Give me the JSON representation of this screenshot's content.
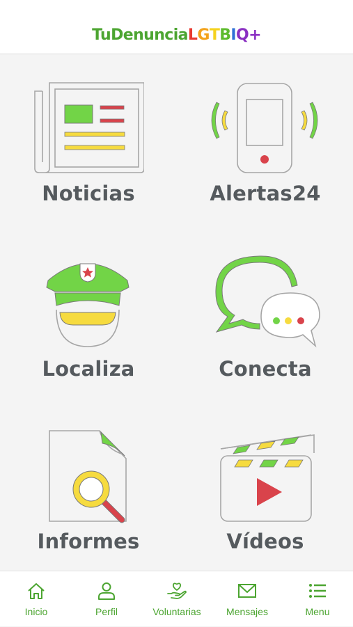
{
  "header": {
    "logo_parts": [
      {
        "text": "TuDenuncia",
        "color": "#4ca531"
      },
      {
        "text": "L",
        "color": "#e8392f"
      },
      {
        "text": "G",
        "color": "#f3a21b"
      },
      {
        "text": "T",
        "color": "#f5d21e"
      },
      {
        "text": "B",
        "color": "#5dbb2d"
      },
      {
        "text": "I",
        "color": "#2f6fd6"
      },
      {
        "text": "Q+",
        "color": "#8a2fc2"
      }
    ]
  },
  "grid": {
    "noticias": {
      "label": "Noticias",
      "icon": "newspaper-icon"
    },
    "alertas": {
      "label": "Alertas24",
      "icon": "phone-alert-icon"
    },
    "localiza": {
      "label": "Localiza",
      "icon": "police-officer-icon"
    },
    "conecta": {
      "label": "Conecta",
      "icon": "chat-bubbles-icon"
    },
    "informes": {
      "label": "Informes",
      "icon": "document-search-icon"
    },
    "videos": {
      "label": "Vídeos",
      "icon": "clapperboard-icon"
    }
  },
  "tabbar": {
    "inicio": {
      "label": "Inicio",
      "icon": "home-icon"
    },
    "perfil": {
      "label": "Perfil",
      "icon": "user-icon"
    },
    "voluntarias": {
      "label": "Voluntarias",
      "icon": "heart-hand-icon"
    },
    "mensajes": {
      "label": "Mensajes",
      "icon": "envelope-icon"
    },
    "menu": {
      "label": "Menu",
      "icon": "list-icon"
    }
  },
  "colors": {
    "green": "#72d447",
    "yellow": "#f6db3f",
    "red": "#d9434b",
    "outline": "#a6a6a6",
    "label": "#555a5e",
    "tab_green": "#4ca531"
  }
}
